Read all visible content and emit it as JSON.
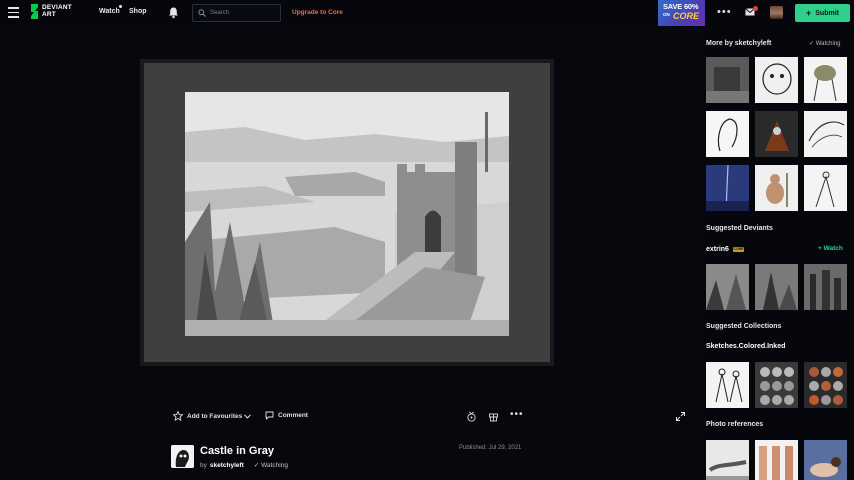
{
  "topbar": {
    "logo_line1": "DEVIANT",
    "logo_line2": "ART",
    "nav_watch": "Watch",
    "nav_shop": "Shop",
    "search_placeholder": "Search",
    "upgrade": "Upgrade to Core",
    "promo_line1": "SAVE 60%",
    "promo_on": "ON",
    "promo_core": "CORE",
    "submit": "Submit",
    "accent_color": "#2fcf8c",
    "upgrade_color": "#f26b3a"
  },
  "actions": {
    "add_favourites": "Add to Favourites",
    "comment": "Comment"
  },
  "deviation": {
    "title": "Castle in Gray",
    "by": "by",
    "author": "sketchyleft",
    "watching": "Watching",
    "published": "Published: Jul 29, 2021"
  },
  "sidebar": {
    "more_by": "More by sketchyleft",
    "watching": "Watching",
    "suggested_deviants": "Suggested Deviants",
    "deviant_name": "extrin6",
    "deviant_badge": "CORE",
    "watch": "Watch",
    "suggested_collections": "Suggested Collections",
    "collection_name": "Sketches.Colored.Inked",
    "photo_references": "Photo references"
  },
  "icons": {
    "menu": "hamburger-menu-icon",
    "bell": "bell-icon",
    "search": "search-icon",
    "notifications": "envelope-icon",
    "favourite": "star-icon",
    "comment": "speech-bubble-icon",
    "badge": "award-badge-icon",
    "gift": "gift-icon",
    "expand": "expand-arrows-icon"
  }
}
